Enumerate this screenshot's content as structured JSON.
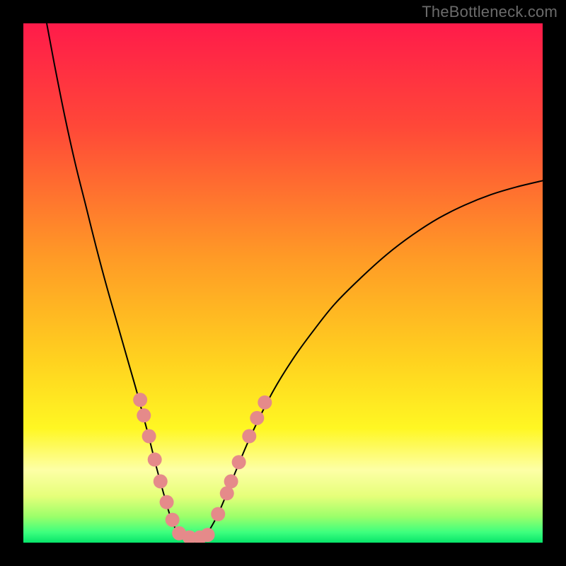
{
  "watermark": "TheBottleneck.com",
  "chart_data": {
    "type": "line",
    "title": "",
    "xlabel": "",
    "ylabel": "",
    "xlim": [
      0,
      100
    ],
    "ylim": [
      0,
      100
    ],
    "axes_visible": false,
    "grid": false,
    "background": {
      "type": "vertical_gradient",
      "stops": [
        {
          "pos": 0.0,
          "color": "#ff1b4a"
        },
        {
          "pos": 0.2,
          "color": "#ff4838"
        },
        {
          "pos": 0.45,
          "color": "#ff9a26"
        },
        {
          "pos": 0.65,
          "color": "#ffd21f"
        },
        {
          "pos": 0.78,
          "color": "#fff723"
        },
        {
          "pos": 0.86,
          "color": "#fdffa6"
        },
        {
          "pos": 0.91,
          "color": "#e6ff7a"
        },
        {
          "pos": 0.95,
          "color": "#9bff6a"
        },
        {
          "pos": 0.98,
          "color": "#3dff7e"
        },
        {
          "pos": 1.0,
          "color": "#07e46a"
        }
      ]
    },
    "series": [
      {
        "name": "left-curve",
        "color": "#000000",
        "x": [
          4.5,
          6,
          8,
          10,
          12,
          14,
          16,
          18,
          20,
          22,
          24,
          25.5,
          27,
          28.5,
          30
        ],
        "y": [
          100,
          92,
          82,
          73,
          65,
          57,
          49.5,
          42.5,
          35.5,
          28.5,
          21,
          15,
          9.5,
          4.5,
          1.5
        ]
      },
      {
        "name": "valley-flat",
        "color": "#000000",
        "x": [
          30,
          31,
          32,
          33,
          34,
          35
        ],
        "y": [
          1.5,
          1.0,
          0.9,
          0.9,
          1.0,
          1.3
        ]
      },
      {
        "name": "right-curve",
        "color": "#000000",
        "x": [
          35,
          37,
          39,
          41,
          44,
          48,
          52,
          56,
          60,
          65,
          70,
          75,
          80,
          85,
          90,
          95,
          100
        ],
        "y": [
          1.3,
          4.5,
          9,
          14,
          21,
          29,
          35.5,
          41,
          46,
          51,
          55.5,
          59.3,
          62.5,
          65,
          67,
          68.5,
          69.7
        ]
      }
    ],
    "markers": [
      {
        "name": "left-branch-dots",
        "color": "#e58a8a",
        "shape": "circle",
        "radius_px": 10,
        "points": [
          {
            "x": 22.5,
            "y": 27.5
          },
          {
            "x": 23.2,
            "y": 24.5
          },
          {
            "x": 24.2,
            "y": 20.5
          },
          {
            "x": 25.3,
            "y": 16.0
          },
          {
            "x": 26.4,
            "y": 11.8
          },
          {
            "x": 27.6,
            "y": 7.8
          },
          {
            "x": 28.7,
            "y": 4.4
          },
          {
            "x": 30.0,
            "y": 1.8
          }
        ]
      },
      {
        "name": "valley-dots",
        "color": "#e58a8a",
        "shape": "circle",
        "radius_px": 10,
        "points": [
          {
            "x": 32.0,
            "y": 1.0
          },
          {
            "x": 34.0,
            "y": 1.0
          },
          {
            "x": 35.5,
            "y": 1.5
          }
        ]
      },
      {
        "name": "right-branch-dots",
        "color": "#e58a8a",
        "shape": "circle",
        "radius_px": 10,
        "points": [
          {
            "x": 37.5,
            "y": 5.5
          },
          {
            "x": 39.2,
            "y": 9.5
          },
          {
            "x": 40.0,
            "y": 11.8
          },
          {
            "x": 41.5,
            "y": 15.5
          },
          {
            "x": 43.5,
            "y": 20.5
          },
          {
            "x": 45.0,
            "y": 24.0
          },
          {
            "x": 46.5,
            "y": 27.0
          }
        ]
      }
    ]
  }
}
